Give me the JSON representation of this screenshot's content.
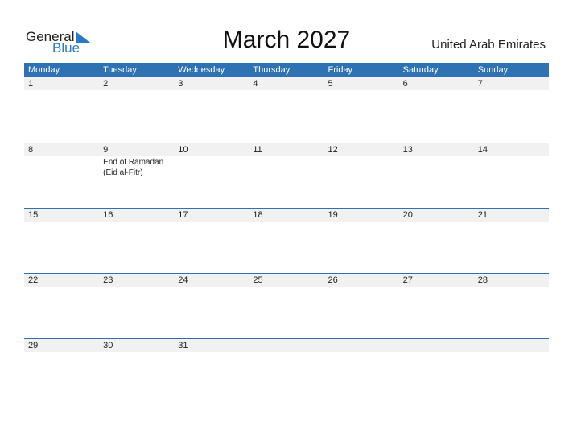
{
  "brand": {
    "general": "General",
    "blue": "Blue"
  },
  "title": "March 2027",
  "country": "United Arab Emirates",
  "weekdays": [
    "Monday",
    "Tuesday",
    "Wednesday",
    "Thursday",
    "Friday",
    "Saturday",
    "Sunday"
  ],
  "weeks": [
    [
      {
        "d": "1"
      },
      {
        "d": "2"
      },
      {
        "d": "3"
      },
      {
        "d": "4"
      },
      {
        "d": "5"
      },
      {
        "d": "6"
      },
      {
        "d": "7"
      }
    ],
    [
      {
        "d": "8"
      },
      {
        "d": "9",
        "e": "End of Ramadan (Eid al-Fitr)"
      },
      {
        "d": "10"
      },
      {
        "d": "11"
      },
      {
        "d": "12"
      },
      {
        "d": "13"
      },
      {
        "d": "14"
      }
    ],
    [
      {
        "d": "15"
      },
      {
        "d": "16"
      },
      {
        "d": "17"
      },
      {
        "d": "18"
      },
      {
        "d": "19"
      },
      {
        "d": "20"
      },
      {
        "d": "21"
      }
    ],
    [
      {
        "d": "22"
      },
      {
        "d": "23"
      },
      {
        "d": "24"
      },
      {
        "d": "25"
      },
      {
        "d": "26"
      },
      {
        "d": "27"
      },
      {
        "d": "28"
      }
    ],
    [
      {
        "d": "29"
      },
      {
        "d": "30"
      },
      {
        "d": "31"
      },
      {
        "d": ""
      },
      {
        "d": ""
      },
      {
        "d": ""
      },
      {
        "d": ""
      }
    ]
  ],
  "colors": {
    "accent": "#2e72b3",
    "logo_blue": "#2a7bc4",
    "day_strip": "#f1f1f1"
  }
}
